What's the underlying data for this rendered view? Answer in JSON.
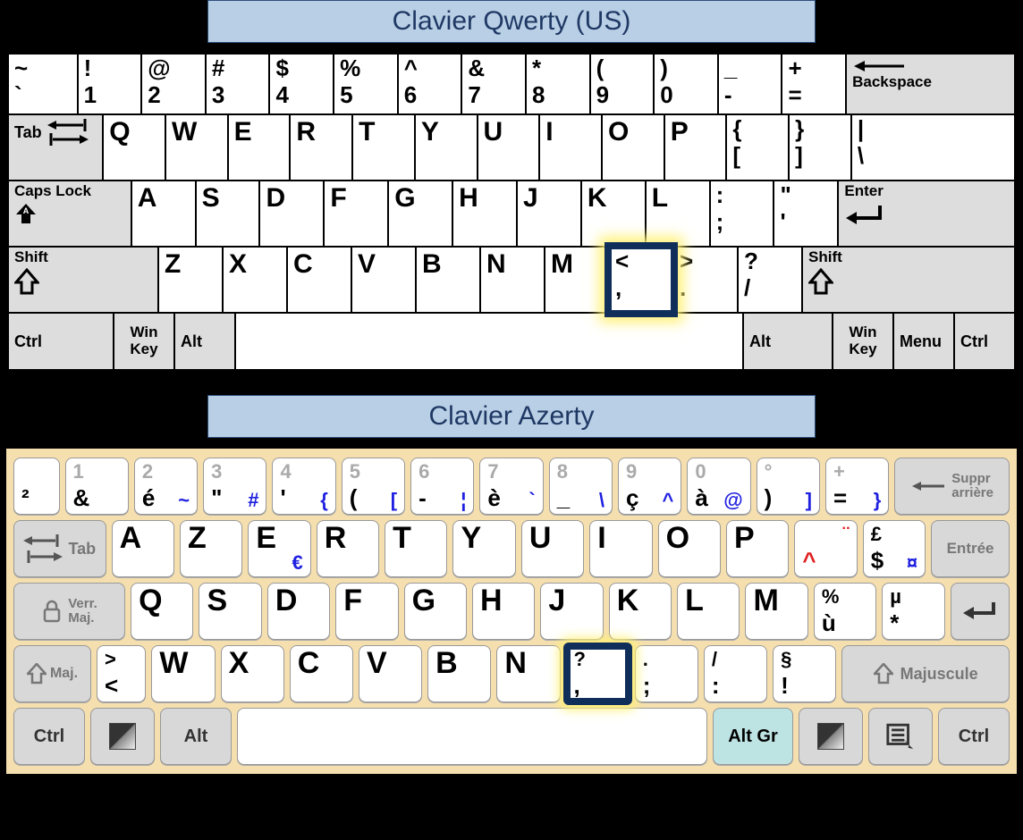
{
  "titles": {
    "qwerty": "Clavier Qwerty (US)",
    "azerty": "Clavier Azerty"
  },
  "qwerty": {
    "row1": [
      {
        "t": "~",
        "b": "`",
        "w": 78,
        "name": "key-backtick"
      },
      {
        "t": "!",
        "b": "1",
        "w": 72,
        "name": "key-1"
      },
      {
        "t": "@",
        "b": "2",
        "w": 72,
        "name": "key-2"
      },
      {
        "t": "#",
        "b": "3",
        "w": 72,
        "name": "key-3"
      },
      {
        "t": "$",
        "b": "4",
        "w": 72,
        "name": "key-4"
      },
      {
        "t": "%",
        "b": "5",
        "w": 72,
        "name": "key-5"
      },
      {
        "t": "^",
        "b": "6",
        "w": 72,
        "name": "key-6"
      },
      {
        "t": "&",
        "b": "7",
        "w": 72,
        "name": "key-7"
      },
      {
        "t": "*",
        "b": "8",
        "w": 72,
        "name": "key-8"
      },
      {
        "t": "(",
        "b": "9",
        "w": 72,
        "name": "key-9"
      },
      {
        "t": ")",
        "b": "0",
        "w": 72,
        "name": "key-0"
      },
      {
        "t": "_",
        "b": "-",
        "w": 72,
        "name": "key-minus"
      },
      {
        "t": "+",
        "b": "=",
        "w": 72,
        "name": "key-equals"
      }
    ],
    "backspace_label": "Backspace",
    "tab_label": "Tab",
    "row2": [
      {
        "c": "Q",
        "w": 72,
        "name": "key-q"
      },
      {
        "c": "W",
        "w": 72,
        "name": "key-w"
      },
      {
        "c": "E",
        "w": 72,
        "name": "key-e"
      },
      {
        "c": "R",
        "w": 72,
        "name": "key-r"
      },
      {
        "c": "T",
        "w": 72,
        "name": "key-t"
      },
      {
        "c": "Y",
        "w": 72,
        "name": "key-y"
      },
      {
        "c": "U",
        "w": 72,
        "name": "key-u"
      },
      {
        "c": "I",
        "w": 72,
        "name": "key-i"
      },
      {
        "c": "O",
        "w": 72,
        "name": "key-o"
      },
      {
        "c": "P",
        "w": 72,
        "name": "key-p"
      },
      {
        "t": "{",
        "b": "[",
        "w": 72,
        "name": "key-bracket-open"
      },
      {
        "t": "}",
        "b": "]",
        "w": 72,
        "name": "key-bracket-close"
      },
      {
        "t": "|",
        "b": "\\",
        "w": 190,
        "name": "key-backslash"
      }
    ],
    "caps_label": "Caps Lock",
    "row3": [
      {
        "c": "A",
        "w": 72,
        "name": "key-a"
      },
      {
        "c": "S",
        "w": 72,
        "name": "key-s"
      },
      {
        "c": "D",
        "w": 72,
        "name": "key-d"
      },
      {
        "c": "F",
        "w": 72,
        "name": "key-f"
      },
      {
        "c": "G",
        "w": 72,
        "name": "key-g"
      },
      {
        "c": "H",
        "w": 72,
        "name": "key-h"
      },
      {
        "c": "J",
        "w": 72,
        "name": "key-j"
      },
      {
        "c": "K",
        "w": 72,
        "name": "key-k"
      },
      {
        "c": "L",
        "w": 72,
        "name": "key-l"
      },
      {
        "t": ":",
        "b": ";",
        "w": 72,
        "name": "key-semicolon"
      },
      {
        "t": "\"",
        "b": "'",
        "w": 72,
        "name": "key-quote"
      }
    ],
    "enter_label": "Enter",
    "shift_label": "Shift",
    "row4": [
      {
        "c": "Z",
        "w": 72,
        "name": "key-z"
      },
      {
        "c": "X",
        "w": 72,
        "name": "key-x"
      },
      {
        "c": "C",
        "w": 72,
        "name": "key-c"
      },
      {
        "c": "V",
        "w": 72,
        "name": "key-v"
      },
      {
        "c": "B",
        "w": 72,
        "name": "key-b"
      },
      {
        "c": "N",
        "w": 72,
        "name": "key-n"
      },
      {
        "c": "M",
        "w": 72,
        "name": "key-m"
      },
      {
        "t": "<",
        "b": ",",
        "w": 72,
        "name": "key-comma",
        "hl": true
      },
      {
        "t": ">",
        "b": ".",
        "w": 72,
        "name": "key-period"
      },
      {
        "t": "?",
        "b": "/",
        "w": 72,
        "name": "key-slash"
      }
    ],
    "ctrl_label": "Ctrl",
    "win_label": "Win Key",
    "alt_label": "Alt",
    "menu_label": "Menu"
  },
  "azerty": {
    "row1_first": {
      "bl": "²",
      "name": "key-squared"
    },
    "row1": [
      {
        "tl": "1",
        "bl": "&",
        "name": "key-a1"
      },
      {
        "tl": "2",
        "bl": "é",
        "br": "~",
        "name": "key-a2"
      },
      {
        "tl": "3",
        "bl": "\"",
        "br": "#",
        "name": "key-a3"
      },
      {
        "tl": "4",
        "bl": "'",
        "br": "{",
        "name": "key-a4"
      },
      {
        "tl": "5",
        "bl": "(",
        "br": "[",
        "name": "key-a5"
      },
      {
        "tl": "6",
        "bl": "-",
        "br": "¦",
        "name": "key-a6"
      },
      {
        "tl": "7",
        "bl": "è",
        "br": "`",
        "name": "key-a7"
      },
      {
        "tl": "8",
        "bl": "_",
        "br": "\\",
        "name": "key-a8"
      },
      {
        "tl": "9",
        "bl": "ç",
        "br": "^",
        "name": "key-a9"
      },
      {
        "tl": "0",
        "bl": "à",
        "br": "@",
        "name": "key-a0"
      },
      {
        "tl": "°",
        "bl": ")",
        "br": "]",
        "name": "key-a-paren"
      },
      {
        "tl": "+",
        "bl": "=",
        "br": "}",
        "name": "key-a-equals"
      }
    ],
    "suppr_label": "Suppr arrière",
    "tab_label": "Tab",
    "row2": [
      {
        "c": "A",
        "name": "key-aa"
      },
      {
        "c": "Z",
        "name": "key-az"
      },
      {
        "c": "E",
        "br": "€",
        "name": "key-ae"
      },
      {
        "c": "R",
        "name": "key-ar"
      },
      {
        "c": "T",
        "name": "key-at"
      },
      {
        "c": "Y",
        "name": "key-ay"
      },
      {
        "c": "U",
        "name": "key-au"
      },
      {
        "c": "I",
        "name": "key-ai"
      },
      {
        "c": "O",
        "name": "key-ao"
      },
      {
        "c": "P",
        "name": "key-ap"
      },
      {
        "tr": "¨",
        "bl_red": "^",
        "name": "key-a-circ"
      },
      {
        "tl_b": "£",
        "bl": "$",
        "br": "¤",
        "name": "key-a-dollar"
      }
    ],
    "entree_label": "Entrée",
    "verr_label": "Verr. Maj.",
    "row3": [
      {
        "c": "Q",
        "name": "key-aq"
      },
      {
        "c": "S",
        "name": "key-as"
      },
      {
        "c": "D",
        "name": "key-ad"
      },
      {
        "c": "F",
        "name": "key-af"
      },
      {
        "c": "G",
        "name": "key-ag"
      },
      {
        "c": "H",
        "name": "key-ah"
      },
      {
        "c": "J",
        "name": "key-aj"
      },
      {
        "c": "K",
        "name": "key-ak"
      },
      {
        "c": "L",
        "name": "key-al"
      },
      {
        "c": "M",
        "name": "key-am"
      },
      {
        "tl_b": "%",
        "bl": "ù",
        "name": "key-a-percent"
      },
      {
        "tl_b": "µ",
        "bl": "*",
        "name": "key-a-mu"
      }
    ],
    "maj_label": "Maj.",
    "row4_first": {
      "tl_b": ">",
      "bl": "<",
      "name": "key-a-ltgt"
    },
    "row4": [
      {
        "c": "W",
        "name": "key-aw"
      },
      {
        "c": "X",
        "name": "key-ax"
      },
      {
        "c": "C",
        "name": "key-ac"
      },
      {
        "c": "V",
        "name": "key-av"
      },
      {
        "c": "B",
        "name": "key-ab"
      },
      {
        "c": "N",
        "name": "key-an"
      },
      {
        "tl_b": "?",
        "bl": ",",
        "name": "key-a-comma",
        "hl": true
      },
      {
        "tl_b": ".",
        "bl": ";",
        "name": "key-a-semi"
      },
      {
        "tl_b": "/",
        "bl": ":",
        "name": "key-a-colon"
      },
      {
        "tl_b": "§",
        "bl": "!",
        "name": "key-a-excl"
      }
    ],
    "majuscule_label": "Majuscule",
    "ctrl_label": "Ctrl",
    "alt_label": "Alt",
    "altgr_label": "Alt Gr"
  }
}
